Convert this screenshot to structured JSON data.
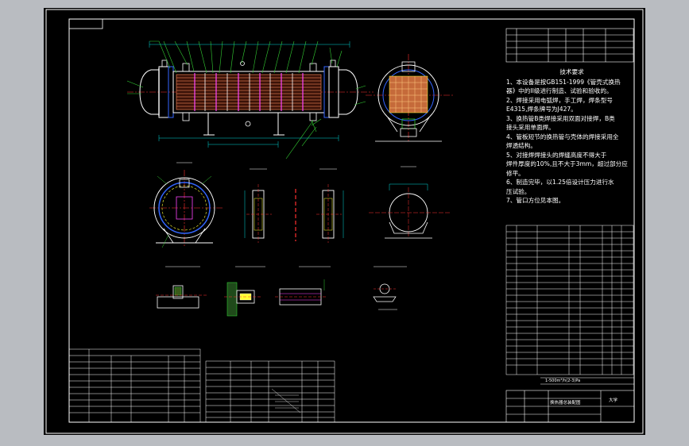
{
  "drawing": {
    "notes_title": "技术要求",
    "notes": [
      "1、本设备是按GB151-1999《管壳式换热",
      "器》中的II级进行制造、试验和验收的。",
      "2、焊接采用电弧焊，手工焊，焊条型号",
      "E4315,焊条牌号为J427。",
      "3、换热管B类焊接采用双面对接焊，B类",
      "接头采用单面焊。",
      "4、管板短节的换热管与壳体的焊接采用全",
      "焊透结构。",
      "5、对接焊焊接头的焊缝高度不得大于",
      "焊件厚度的10%,且不大于3mm，超过部分应",
      "修平。",
      "6、制造完毕，以1.25倍设计压力进行水",
      "压试验。",
      "7、管口方位见本图。"
    ],
    "bom_footer": "1-500m³/h(2-3)Pa",
    "title_block_name": "换热器总装配图",
    "company": "大学"
  },
  "colors": {
    "background": "#b9bcc1",
    "sheet": "#000000",
    "lines": "#ffffff",
    "dimensions": "#00d9d9",
    "centerlines": "#ff3030",
    "leaders": "#33cc33",
    "tube_bundle": "#d07048",
    "highlight": "#ffff33",
    "baffles": "#ff44ff",
    "nozzles": "#3366ff"
  }
}
